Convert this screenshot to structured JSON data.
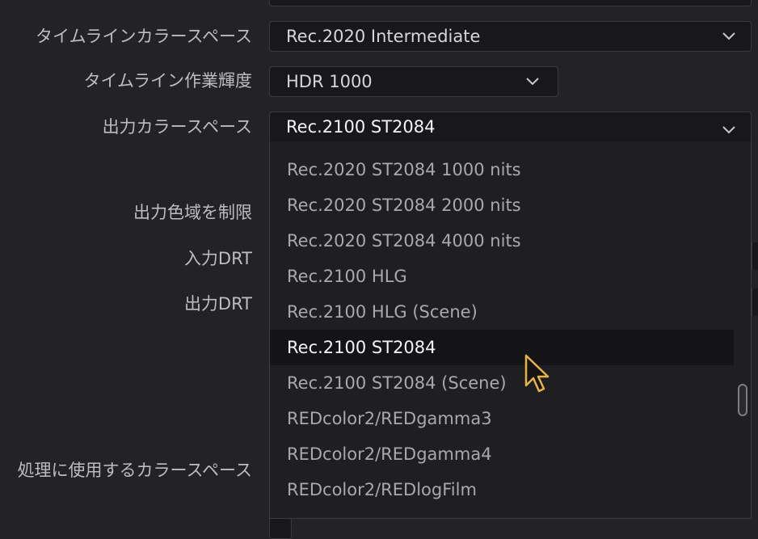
{
  "settings": {
    "timeline_color_space": {
      "label": "タイムラインカラースペース",
      "value": "Rec.2020 Intermediate"
    },
    "timeline_working_luminance": {
      "label": "タイムライン作業輝度",
      "value": "HDR 1000"
    },
    "output_color_space": {
      "label": "出力カラースペース",
      "value": "Rec.2100 ST2084"
    },
    "limit_output_gamut": {
      "label": "出力色域を制限"
    },
    "input_drt": {
      "label": "入力DRT"
    },
    "output_drt": {
      "label": "出力DRT"
    },
    "processing_color_space": {
      "label": "処理に使用するカラースペース"
    }
  },
  "dropdown": {
    "options": [
      "Rec.2020 ST2084 1000 nits",
      "Rec.2020 ST2084 2000 nits",
      "Rec.2020 ST2084 4000 nits",
      "Rec.2100 HLG",
      "Rec.2100 HLG (Scene)",
      "Rec.2100 ST2084",
      "Rec.2100 ST2084 (Scene)",
      "REDcolor2/REDgamma3",
      "REDcolor2/REDgamma4",
      "REDcolor2/REDlogFilm"
    ],
    "selected_index": 5
  },
  "colors": {
    "background": "#232325",
    "field": "#18181a",
    "selected_text": "#f4f4f6",
    "cursor_outline": "#e8b24a"
  }
}
